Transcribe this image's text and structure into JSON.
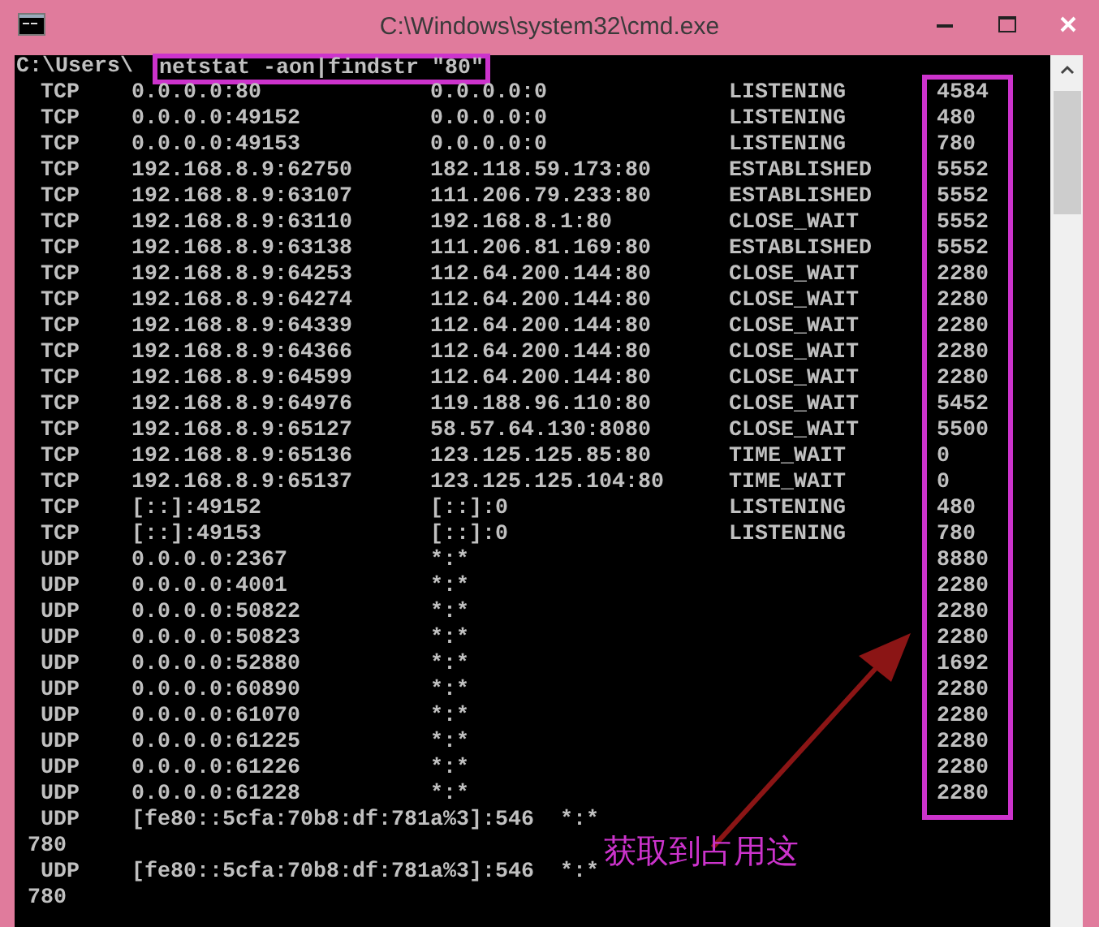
{
  "window": {
    "title": "C:\\Windows\\system32\\cmd.exe"
  },
  "console": {
    "prompt": "C:\\Users\\",
    "command": "netstat -aon|findstr \"80\"",
    "rows": [
      {
        "kind": "row",
        "proto": "TCP",
        "local": "0.0.0.0:80",
        "foreign": "0.0.0.0:0",
        "state": "LISTENING",
        "pid": "4584"
      },
      {
        "kind": "row",
        "proto": "TCP",
        "local": "0.0.0.0:49152",
        "foreign": "0.0.0.0:0",
        "state": "LISTENING",
        "pid": "480"
      },
      {
        "kind": "row",
        "proto": "TCP",
        "local": "0.0.0.0:49153",
        "foreign": "0.0.0.0:0",
        "state": "LISTENING",
        "pid": "780"
      },
      {
        "kind": "row",
        "proto": "TCP",
        "local": "192.168.8.9:62750",
        "foreign": "182.118.59.173:80",
        "state": "ESTABLISHED",
        "pid": "5552"
      },
      {
        "kind": "row",
        "proto": "TCP",
        "local": "192.168.8.9:63107",
        "foreign": "111.206.79.233:80",
        "state": "ESTABLISHED",
        "pid": "5552"
      },
      {
        "kind": "row",
        "proto": "TCP",
        "local": "192.168.8.9:63110",
        "foreign": "192.168.8.1:80",
        "state": "CLOSE_WAIT",
        "pid": "5552"
      },
      {
        "kind": "row",
        "proto": "TCP",
        "local": "192.168.8.9:63138",
        "foreign": "111.206.81.169:80",
        "state": "ESTABLISHED",
        "pid": "5552"
      },
      {
        "kind": "row",
        "proto": "TCP",
        "local": "192.168.8.9:64253",
        "foreign": "112.64.200.144:80",
        "state": "CLOSE_WAIT",
        "pid": "2280"
      },
      {
        "kind": "row",
        "proto": "TCP",
        "local": "192.168.8.9:64274",
        "foreign": "112.64.200.144:80",
        "state": "CLOSE_WAIT",
        "pid": "2280"
      },
      {
        "kind": "row",
        "proto": "TCP",
        "local": "192.168.8.9:64339",
        "foreign": "112.64.200.144:80",
        "state": "CLOSE_WAIT",
        "pid": "2280"
      },
      {
        "kind": "row",
        "proto": "TCP",
        "local": "192.168.8.9:64366",
        "foreign": "112.64.200.144:80",
        "state": "CLOSE_WAIT",
        "pid": "2280"
      },
      {
        "kind": "row",
        "proto": "TCP",
        "local": "192.168.8.9:64599",
        "foreign": "112.64.200.144:80",
        "state": "CLOSE_WAIT",
        "pid": "2280"
      },
      {
        "kind": "row",
        "proto": "TCP",
        "local": "192.168.8.9:64976",
        "foreign": "119.188.96.110:80",
        "state": "CLOSE_WAIT",
        "pid": "5452"
      },
      {
        "kind": "row",
        "proto": "TCP",
        "local": "192.168.8.9:65127",
        "foreign": "58.57.64.130:8080",
        "state": "CLOSE_WAIT",
        "pid": "5500"
      },
      {
        "kind": "row",
        "proto": "TCP",
        "local": "192.168.8.9:65136",
        "foreign": "123.125.125.85:80",
        "state": "TIME_WAIT",
        "pid": "0"
      },
      {
        "kind": "row",
        "proto": "TCP",
        "local": "192.168.8.9:65137",
        "foreign": "123.125.125.104:80",
        "state": "TIME_WAIT",
        "pid": "0"
      },
      {
        "kind": "row",
        "proto": "TCP",
        "local": "[::]:49152",
        "foreign": "[::]:0",
        "state": "LISTENING",
        "pid": "480"
      },
      {
        "kind": "row",
        "proto": "TCP",
        "local": "[::]:49153",
        "foreign": "[::]:0",
        "state": "LISTENING",
        "pid": "780"
      },
      {
        "kind": "row",
        "proto": "UDP",
        "local": "0.0.0.0:2367",
        "foreign": "*:*",
        "pid": "8880"
      },
      {
        "kind": "row",
        "proto": "UDP",
        "local": "0.0.0.0:4001",
        "foreign": "*:*",
        "pid": "2280"
      },
      {
        "kind": "row",
        "proto": "UDP",
        "local": "0.0.0.0:50822",
        "foreign": "*:*",
        "pid": "2280"
      },
      {
        "kind": "row",
        "proto": "UDP",
        "local": "0.0.0.0:50823",
        "foreign": "*:*",
        "pid": "2280"
      },
      {
        "kind": "row",
        "proto": "UDP",
        "local": "0.0.0.0:52880",
        "foreign": "*:*",
        "pid": "1692"
      },
      {
        "kind": "row",
        "proto": "UDP",
        "local": "0.0.0.0:60890",
        "foreign": "*:*",
        "pid": "2280"
      },
      {
        "kind": "row",
        "proto": "UDP",
        "local": "0.0.0.0:61070",
        "foreign": "*:*",
        "pid": "2280"
      },
      {
        "kind": "row",
        "proto": "UDP",
        "local": "0.0.0.0:61225",
        "foreign": "*:*",
        "pid": "2280"
      },
      {
        "kind": "row",
        "proto": "UDP",
        "local": "0.0.0.0:61226",
        "foreign": "*:*",
        "pid": "2280"
      },
      {
        "kind": "row",
        "proto": "UDP",
        "local": "0.0.0.0:61228",
        "foreign": "*:*",
        "pid": "2280"
      },
      {
        "kind": "wrapped",
        "proto": "UDP",
        "local": "[fe80::5cfa:70b8:df:781a%3]:546",
        "foreign": "*:*",
        "pid": "780"
      },
      {
        "kind": "wrapped",
        "proto": "UDP",
        "local": "[fe80::5cfa:70b8:df:781a%3]:546",
        "foreign": "*:*",
        "pid": "780"
      }
    ]
  },
  "annotation": {
    "text": "获取到占用这"
  }
}
